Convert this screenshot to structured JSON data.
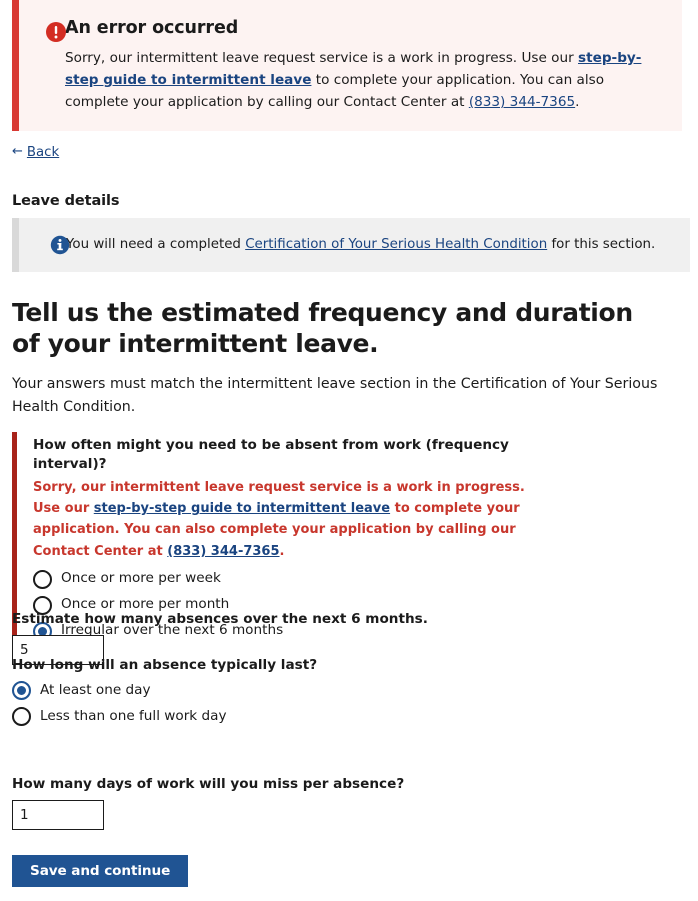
{
  "error_alert": {
    "icon": "error-exclamation-icon",
    "heading": "An error occurred",
    "body_part1": "Sorry, our intermittent leave request service is a work in progress. Use our ",
    "link1": "step-by-step guide to intermittent leave",
    "body_part2": " to complete your application. You can also complete your application by calling our Contact Center at ",
    "phone_link": "(833) 344-7365",
    "body_part3": ".",
    "accent_color": "#d83933",
    "background_color": "#fdf3f2"
  },
  "back_link": {
    "arrow": "←",
    "label": "Back"
  },
  "section": {
    "title": "Leave details"
  },
  "info_alert": {
    "icon": "info-circle-icon",
    "text_before": "You will need a completed ",
    "link": "Certification of Your Serious Health Condition",
    "text_after": " for this section.",
    "background_color": "#f0f0f0"
  },
  "main": {
    "heading": "Tell us the estimated frequency and duration of your intermittent leave.",
    "lead": "Your answers must match the intermittent leave section in the Certification of Your Serious Health Condition."
  },
  "frequency_fieldset": {
    "legend": "How often might you need to be absent from work (frequency interval)?",
    "error_color": "#c8372d",
    "error_border_color": "#a8231a",
    "error_part1": "Sorry, our intermittent leave request service is a work in progress. Use our ",
    "error_link1": "step-by-step guide to intermittent leave",
    "error_part2": " to complete your application. You can also complete your application by calling our Contact Center at ",
    "error_phone": "(833) 344-7365",
    "error_part3": ".",
    "options": [
      {
        "label": "Once or more per week",
        "checked": false
      },
      {
        "label": "Once or more per month",
        "checked": false
      },
      {
        "label": "Irregular over the next 6 months",
        "checked": true
      }
    ]
  },
  "absences_field": {
    "label": "Estimate how many absences over the next 6 months.",
    "value": "5"
  },
  "duration_fieldset": {
    "legend": "How long will an absence typically last?",
    "options": [
      {
        "label": "At least one day",
        "checked": true
      },
      {
        "label": "Less than one full work day",
        "checked": false
      }
    ]
  },
  "days_missed_field": {
    "label": "How many days of work will you miss per absence?",
    "value": "1"
  },
  "submit": {
    "label": "Save and continue",
    "color": "#205493"
  }
}
